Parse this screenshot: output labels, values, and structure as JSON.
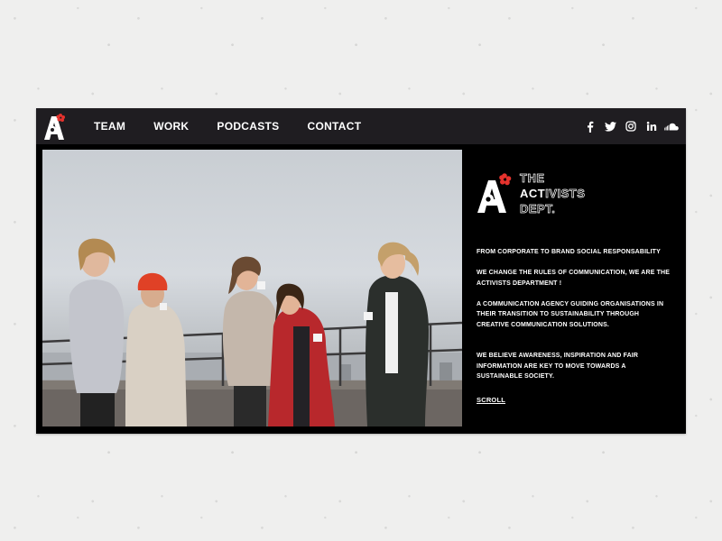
{
  "nav": {
    "items": [
      "TEAM",
      "WORK",
      "PODCASTS",
      "CONTACT"
    ]
  },
  "social_icons": [
    "facebook-icon",
    "twitter-icon",
    "instagram-icon",
    "linkedin-icon",
    "soundcloud-icon"
  ],
  "brand": {
    "line1": "THE",
    "line2_strong": "ACT",
    "line2_rest": "IVISTS",
    "line3": "DEPT."
  },
  "hero": {
    "p1": "FROM CORPORATE TO BRAND SOCIAL RESPONSABILITY",
    "p2": "WE CHANGE THE RULES OF COMMUNICATION, WE ARE THE ACTIVISTS DEPARTMENT !",
    "p3": "A COMMUNICATION AGENCY GUIDING ORGANISATIONS IN THEIR TRANSITION TO SUSTAINABILITY THROUGH CREATIVE COMMUNICATION SOLUTIONS.",
    "p4": "WE BELIEVE AWARENESS, INSPIRATION AND FAIR INFORMATION ARE KEY TO MOVE TOWARDS A SUSTAINABLE SOCIETY.",
    "scroll": "SCROLL"
  },
  "colors": {
    "nav_bg": "#1f1d21",
    "panel_bg": "#000000",
    "accent_red": "#e5322d",
    "page_bg": "#efefee"
  }
}
